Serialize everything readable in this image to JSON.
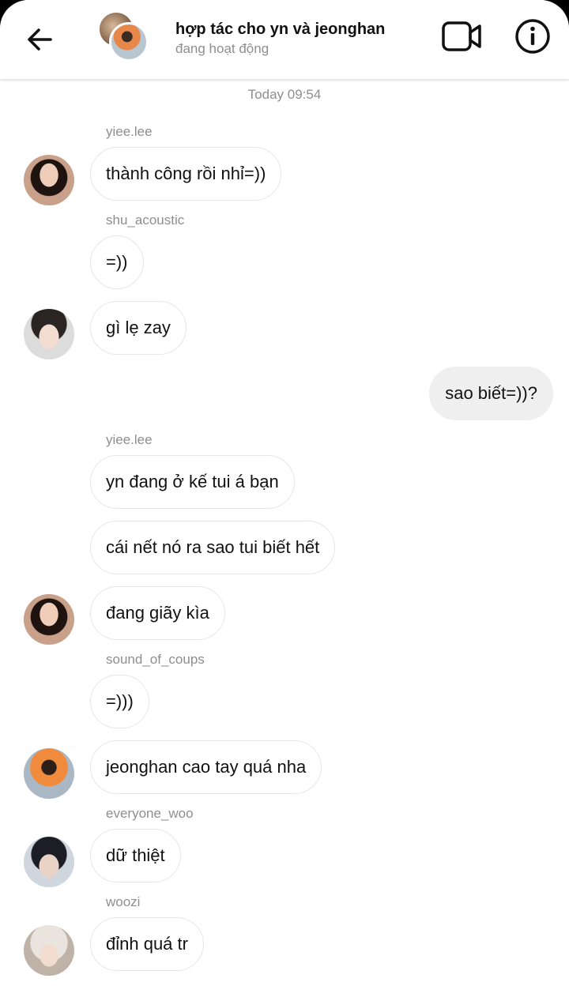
{
  "header": {
    "title": "hợp tác cho yn và jeonghan",
    "status": "đang hoạt động",
    "icons": {
      "back": "back-arrow-icon",
      "video": "video-call-icon",
      "info": "info-icon"
    }
  },
  "chat": {
    "date_label": "Today 09:54",
    "messages": [
      {
        "sender": "yiee.lee",
        "text": "thành công rồi nhỉ=))"
      },
      {
        "sender": "shu_acoustic",
        "text": "=))"
      },
      {
        "text": "gì lẹ zay"
      },
      {
        "text": "sao biết=))?",
        "mine": true
      },
      {
        "sender": "yiee.lee",
        "text": "yn đang ở kế tui á bạn"
      },
      {
        "text": "cái nết nó ra sao tui biết hết"
      },
      {
        "text": "đang giãy kìa"
      },
      {
        "sender": "sound_of_coups",
        "text": "=)))"
      },
      {
        "text": "jeonghan cao tay quá nha"
      },
      {
        "sender": "everyone_woo",
        "text": "dữ thiệt"
      },
      {
        "sender": "woozi",
        "text": "đỉnh quá tr"
      }
    ]
  },
  "colors": {
    "secondary_text": "#8e8e8e",
    "my_bubble": "#efefef",
    "bubble_border": "#e6e6e6"
  }
}
